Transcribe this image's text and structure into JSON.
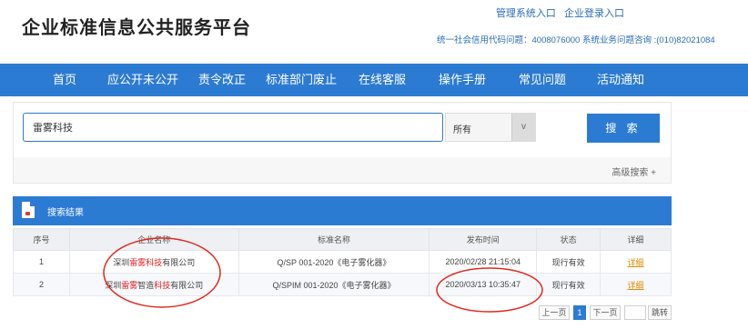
{
  "header": {
    "site_title": "企业标准信息公共服务平台",
    "admin_entry": "管理系统入口",
    "company_login": "企业登录入口",
    "hotline": "统一社会信用代码问题：4008076000 系统业务问题咨询 :(010)82021084"
  },
  "nav": {
    "items": [
      "首页",
      "应公开未公开",
      "责令改正",
      "标准部门废止",
      "在线客服",
      "操作手册",
      "常见问题",
      "活动通知"
    ]
  },
  "search": {
    "query": "雷雾科技",
    "scope_selected": "所有",
    "scope_arrow": "v",
    "button_label": "搜 索",
    "advanced_label": "高级搜索 +"
  },
  "results": {
    "title": "搜索结果",
    "columns": [
      "序号",
      "企业名称",
      "标准名称",
      "发布时间",
      "状态",
      "详细"
    ],
    "rows": [
      {
        "index": "1",
        "company_prefix": "深圳",
        "company_hl1": "雷雾科技",
        "company_mid": "",
        "company_hl2": "",
        "company_suffix": "有限公司",
        "standard": "Q/SP 001-2020《电子雾化器》",
        "published": "2020/02/28 21:15:04",
        "status": "现行有效",
        "detail": "详细"
      },
      {
        "index": "2",
        "company_prefix": "深圳",
        "company_hl1": "雷雾",
        "company_mid": "智造",
        "company_hl2": "科技",
        "company_suffix": "有限公司",
        "standard": "Q/SPIM 001-2020《电子雾化器》",
        "published": "2020/03/13 10:35:47",
        "status": "现行有效",
        "detail": "详细"
      }
    ]
  },
  "pager": {
    "prev": "上一页",
    "current": "1",
    "next": "下一页",
    "jump": "跳转"
  },
  "colors": {
    "nav_bg": "#2c7bd3",
    "highlight": "#e02020",
    "annotation": "#e0281e",
    "link": "#e08c00"
  }
}
